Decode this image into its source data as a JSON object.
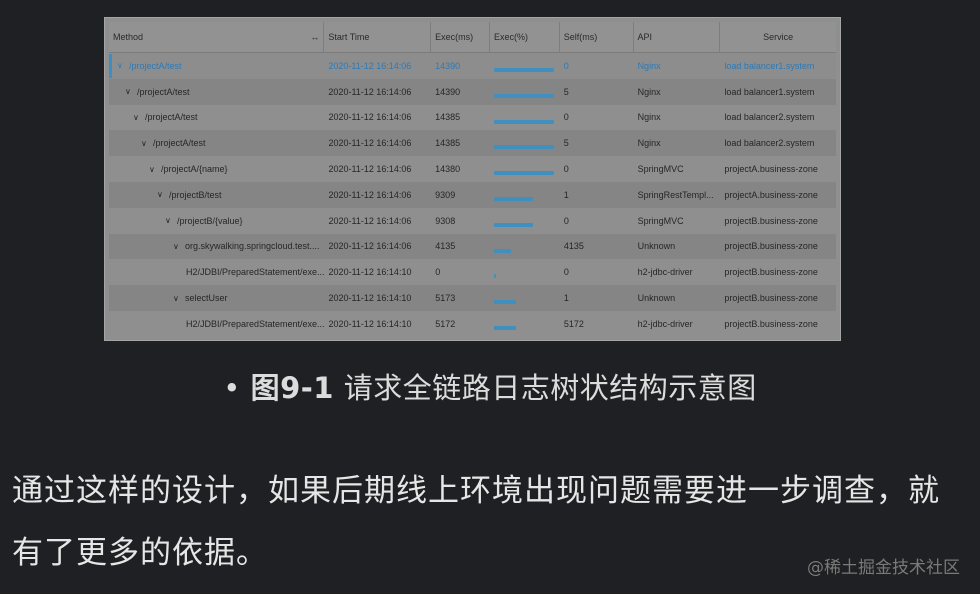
{
  "headers": [
    "Method",
    "Start Time",
    "Exec(ms)",
    "Exec(%)",
    "Self(ms)",
    "API",
    "Service"
  ],
  "resize_glyph": "↔",
  "rows": [
    {
      "method": "/projectA/test",
      "depth": 0,
      "start": "2020-11-12 16:14:06",
      "exec": "14390",
      "pct": 1.0,
      "self": "0",
      "api": "Nginx",
      "service": "load balancer1.system",
      "selected": true,
      "expandable": true
    },
    {
      "method": "/projectA/test",
      "depth": 1,
      "start": "2020-11-12 16:14:06",
      "exec": "14390",
      "pct": 1.0,
      "self": "5",
      "api": "Nginx",
      "service": "load balancer1.system",
      "selected": false,
      "expandable": true
    },
    {
      "method": "/projectA/test",
      "depth": 2,
      "start": "2020-11-12 16:14:06",
      "exec": "14385",
      "pct": 1.0,
      "self": "0",
      "api": "Nginx",
      "service": "load balancer2.system",
      "selected": false,
      "expandable": true
    },
    {
      "method": "/projectA/test",
      "depth": 3,
      "start": "2020-11-12 16:14:06",
      "exec": "14385",
      "pct": 1.0,
      "self": "5",
      "api": "Nginx",
      "service": "load balancer2.system",
      "selected": false,
      "expandable": true
    },
    {
      "method": "/projectA/{name}",
      "depth": 4,
      "start": "2020-11-12 16:14:06",
      "exec": "14380",
      "pct": 1.0,
      "self": "0",
      "api": "SpringMVC",
      "service": "projectA.business-zone",
      "selected": false,
      "expandable": true
    },
    {
      "method": "/projectB/test",
      "depth": 5,
      "start": "2020-11-12 16:14:06",
      "exec": "9309",
      "pct": 0.65,
      "self": "1",
      "api": "SpringRestTempl...",
      "service": "projectA.business-zone",
      "selected": false,
      "expandable": true
    },
    {
      "method": "/projectB/{value}",
      "depth": 6,
      "start": "2020-11-12 16:14:06",
      "exec": "9308",
      "pct": 0.65,
      "self": "0",
      "api": "SpringMVC",
      "service": "projectB.business-zone",
      "selected": false,
      "expandable": true
    },
    {
      "method": "org.skywalking.springcloud.test....",
      "depth": 7,
      "start": "2020-11-12 16:14:06",
      "exec": "4135",
      "pct": 0.29,
      "self": "4135",
      "api": "Unknown",
      "service": "projectB.business-zone",
      "selected": false,
      "expandable": true
    },
    {
      "method": "H2/JDBI/PreparedStatement/exe...",
      "depth": 8,
      "start": "2020-11-12 16:14:10",
      "exec": "0",
      "pct": 0.01,
      "self": "0",
      "api": "h2-jdbc-driver",
      "service": "projectB.business-zone",
      "selected": false,
      "expandable": false
    },
    {
      "method": "selectUser",
      "depth": 7,
      "start": "2020-11-12 16:14:10",
      "exec": "5173",
      "pct": 0.36,
      "self": "1",
      "api": "Unknown",
      "service": "projectB.business-zone",
      "selected": false,
      "expandable": true
    },
    {
      "method": "H2/JDBI/PreparedStatement/exe...",
      "depth": 8,
      "start": "2020-11-12 16:14:10",
      "exec": "5172",
      "pct": 0.36,
      "self": "5172",
      "api": "h2-jdbc-driver",
      "service": "projectB.business-zone",
      "selected": false,
      "expandable": false
    }
  ],
  "caption": {
    "bullet": "•",
    "figure_label": "图9-1",
    "title": "请求全链路日志树状结构示意图"
  },
  "body_text": "通过这样的设计，如果后期线上环境出现问题需要进一步调查，就有了更多的依据。",
  "watermark": "@稀土掘金技术社区",
  "colors": {
    "bar": "#3f8fbf",
    "selected_text": "#2c7ab8",
    "background": "#1f2023"
  }
}
